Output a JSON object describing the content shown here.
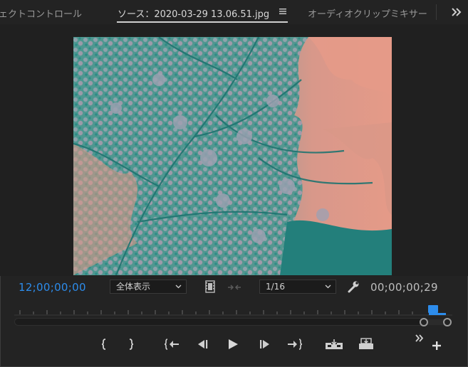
{
  "tabs": [
    {
      "label": "ェクトコントロール"
    },
    {
      "label": "ソース：2020-03-29 13.06.51.jpg"
    },
    {
      "label": "オーディオクリップミキサー"
    }
  ],
  "timecode": {
    "current": "12;00;00;00",
    "duration": "00;00;00;29"
  },
  "zoom_select": {
    "value": "全体表示"
  },
  "resolution_select": {
    "value": "1/16"
  },
  "colors": {
    "accent": "#2d8ceb",
    "background": "#232323",
    "image_pink": "#e59a88",
    "image_teal": "#2a8b86"
  },
  "icons": {
    "panel_menu": "hamburger-icon",
    "overflow": "double-chevron-right-icon",
    "export_frame": "film-frame-icon",
    "compare": "compare-arrows-icon",
    "settings": "wrench-icon"
  },
  "transport_buttons": [
    {
      "name": "mark-in-button",
      "icon": "mark-in-icon"
    },
    {
      "name": "mark-out-button",
      "icon": "mark-out-icon"
    },
    {
      "name": "go-to-in-button",
      "icon": "go-to-in-icon"
    },
    {
      "name": "step-back-button",
      "icon": "step-back-icon"
    },
    {
      "name": "play-button",
      "icon": "play-icon"
    },
    {
      "name": "step-forward-button",
      "icon": "step-forward-icon"
    },
    {
      "name": "go-to-out-button",
      "icon": "go-to-out-icon"
    },
    {
      "name": "insert-button",
      "icon": "insert-icon"
    },
    {
      "name": "overwrite-button",
      "icon": "overwrite-icon"
    }
  ]
}
